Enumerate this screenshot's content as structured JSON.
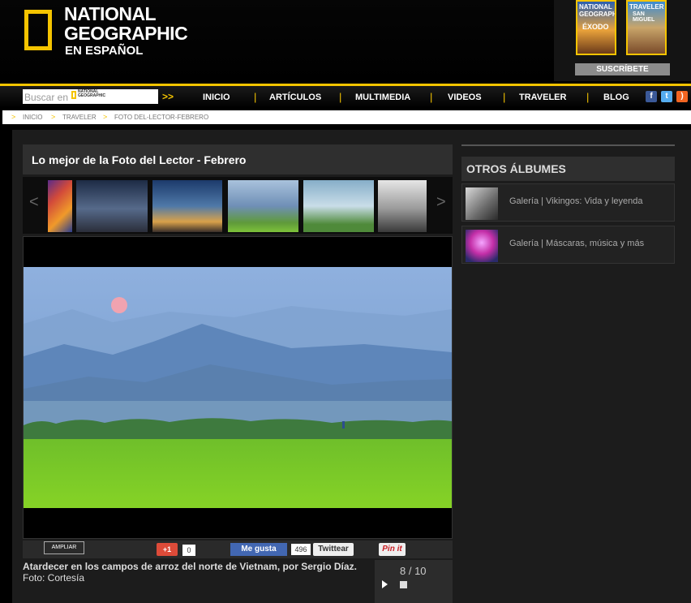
{
  "header": {
    "logo": {
      "line1": "NATIONAL",
      "line2": "GEOGRAPHIC",
      "line3": "EN ESPAÑOL"
    },
    "magazines": [
      {
        "title": "NATIONAL GEOGRAPHIC",
        "headline": "ÉXODO"
      },
      {
        "title": "TRAVELER",
        "headline": "SAN MIGUEL"
      }
    ],
    "subscribe_label": "SUSCRÍBETE"
  },
  "nav": {
    "search_placeholder": "Buscar en",
    "search_logo_text": "NATIONAL GEOGRAPHIC",
    "search_button": ">>",
    "items": [
      "INICIO",
      "ARTÍCULOS",
      "MULTIMEDIA",
      "VIDEOS",
      "TRAVELER",
      "BLOG"
    ],
    "social": [
      "facebook-icon",
      "twitter-icon",
      "rss-icon"
    ]
  },
  "breadcrumb": [
    "INICIO",
    "TRAVELER",
    "FOTO DEL-LECTOR-FEBRERO"
  ],
  "gallery": {
    "title": "Lo mejor de la Foto del Lector - Febrero",
    "toolbar": {
      "ampliar": "AMPLIAR",
      "gplus": "+1",
      "gplus_count": "0",
      "fb_like": "Me gusta",
      "fb_count": "496",
      "twitter": "Twittear",
      "pinit": "Pin it"
    },
    "caption_bold": "Atardecer en los campos de arroz del norte de Vietnam, por Sergio Díaz.",
    "caption_credit": "Foto: Cortesía",
    "counter": "8 / 10"
  },
  "sidebar": {
    "title": "OTROS ÁLBUMES",
    "albums": [
      {
        "label": "Galería | Vikingos: Vida y leyenda"
      },
      {
        "label": "Galería | Máscaras, música y más"
      }
    ]
  },
  "colors": {
    "accent": "#f5c400",
    "background": "#000000",
    "panel": "#1c1c1c"
  }
}
